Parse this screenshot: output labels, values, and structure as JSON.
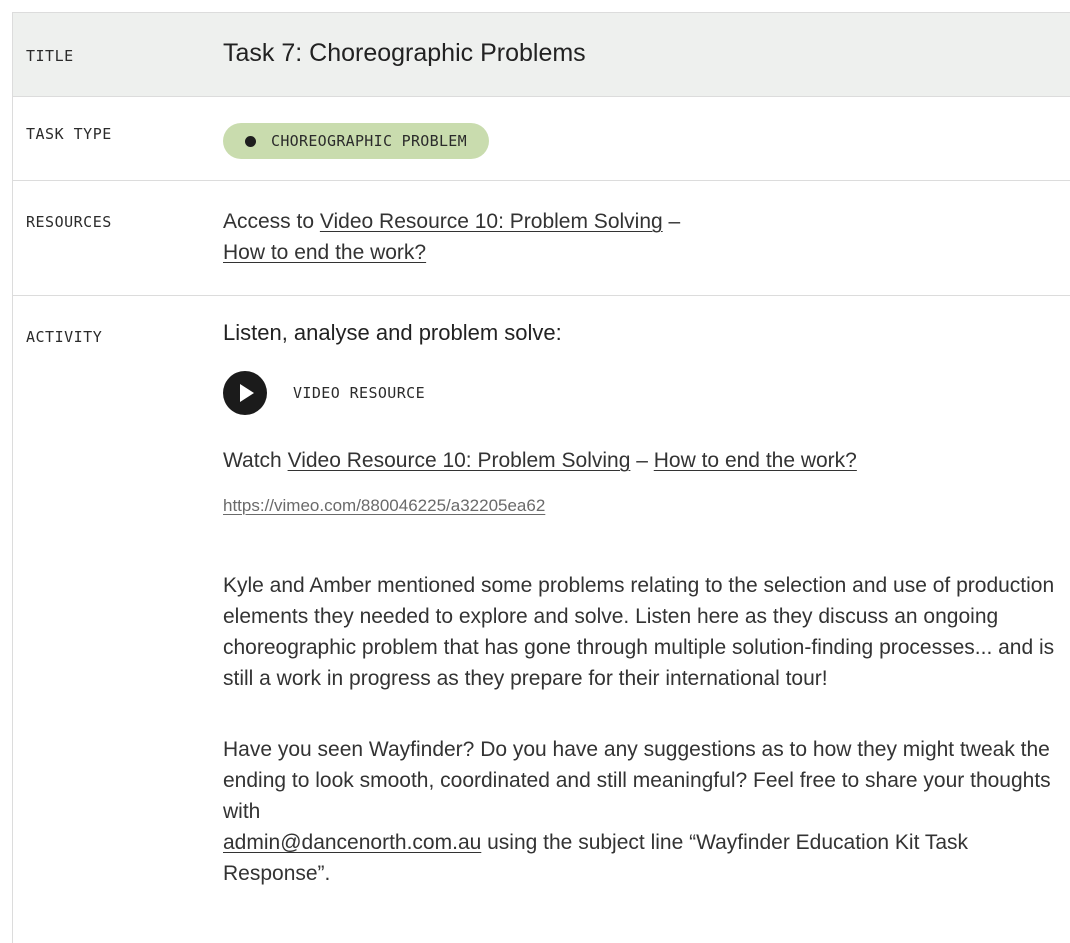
{
  "rows": {
    "title": {
      "label": "TITLE",
      "value": "Task 7: Choreographic Problems"
    },
    "task_type": {
      "label": "TASK TYPE",
      "badge": "CHOREOGRAPHIC PROBLEM"
    },
    "resources": {
      "label": "RESOURCES",
      "prefix": "Access to ",
      "link_line1": "Video Resource 10: Problem Solving",
      "dash": " –",
      "link_line2": "How to end the work?"
    },
    "activity": {
      "label": "ACTIVITY",
      "heading": "Listen, analyse and problem solve:",
      "video_label": "VIDEO RESOURCE",
      "watch_prefix": "Watch ",
      "watch_link_part1": "Video Resource 10: Problem Solving",
      "watch_dash": " – ",
      "watch_link_part2": "How to end the work?",
      "url": "https://vimeo.com/880046225/a32205ea62",
      "para1": "Kyle and Amber mentioned some problems relating to the selection and use of production elements they needed to explore and solve. Listen here as they discuss an ongoing choreographic problem that has gone through multiple solution-finding processes... and is still a work in progress as they prepare for their international tour!",
      "para2_before": "Have you seen Wayfinder? Do you have any suggestions as to how they might tweak the ending to look smooth, coordinated and still meaningful? Feel free to share your thoughts with ",
      "email": "admin@dancenorth.com.au",
      "para2_after": " using the subject line “Wayfinder Education Kit Task Response”."
    }
  },
  "icons": {
    "play": "play-icon",
    "badge_dot": "bullet-dot-icon"
  },
  "colors": {
    "title_row_bg": "#eef0ee",
    "badge_bg": "#c9dcae",
    "border": "#dcdcdc",
    "play_icon_bg": "#1b1b1b"
  }
}
